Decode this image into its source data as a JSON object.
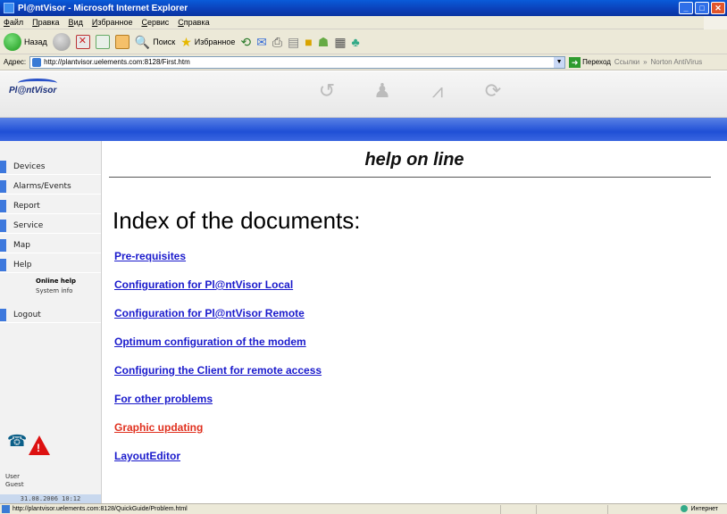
{
  "window": {
    "title": "Pl@ntVisor - Microsoft Internet Explorer"
  },
  "menu": [
    "Файл",
    "Правка",
    "Вид",
    "Избранное",
    "Сервис",
    "Справка"
  ],
  "toolbar": {
    "back_label": "Назад",
    "search_label": "Поиск",
    "favorites_label": "Избранное"
  },
  "address": {
    "label": "Адрес:",
    "url": "http://plantvisor.uelements.com:8128/First.htm",
    "go_label": "Переход",
    "links_label": "Ссылки",
    "antivirus_label": "Norton AntiVirus"
  },
  "header": {
    "logo_text": "Pl@ntVisor"
  },
  "sidebar": {
    "items": [
      {
        "label": "Devices"
      },
      {
        "label": "Alarms/Events"
      },
      {
        "label": "Report"
      },
      {
        "label": "Service"
      },
      {
        "label": "Map"
      },
      {
        "label": "Help"
      },
      {
        "label": "Logout"
      }
    ],
    "sub_items": [
      {
        "label": "Online help"
      },
      {
        "label": "System info"
      }
    ],
    "user_label": "User",
    "user_name": "Guest",
    "datetime": "31.08.2006 10:12"
  },
  "main": {
    "help_title": "help on line",
    "heading": "Index of the documents:",
    "links": [
      {
        "label": "Pre-requisites"
      },
      {
        "label": "Configuration for Pl@ntVisor Local"
      },
      {
        "label": "Configuration for Pl@ntVisor Remote"
      },
      {
        "label": "Optimum configuration of the modem"
      },
      {
        "label": "Configuring the Client for remote access"
      },
      {
        "label": "For other problems"
      },
      {
        "label": "Graphic updating"
      },
      {
        "label": "LayoutEditor"
      }
    ]
  },
  "status": {
    "url": "http://plantvisor.uelements.com:8128/QuickGuide/Problem.html",
    "zone": "Интернет"
  },
  "colors": {
    "link": "#1a1acc",
    "link_visited_red": "#e0301e",
    "blue_band": "#1f4fd6",
    "sidebar_tab": "#3d78dd"
  }
}
